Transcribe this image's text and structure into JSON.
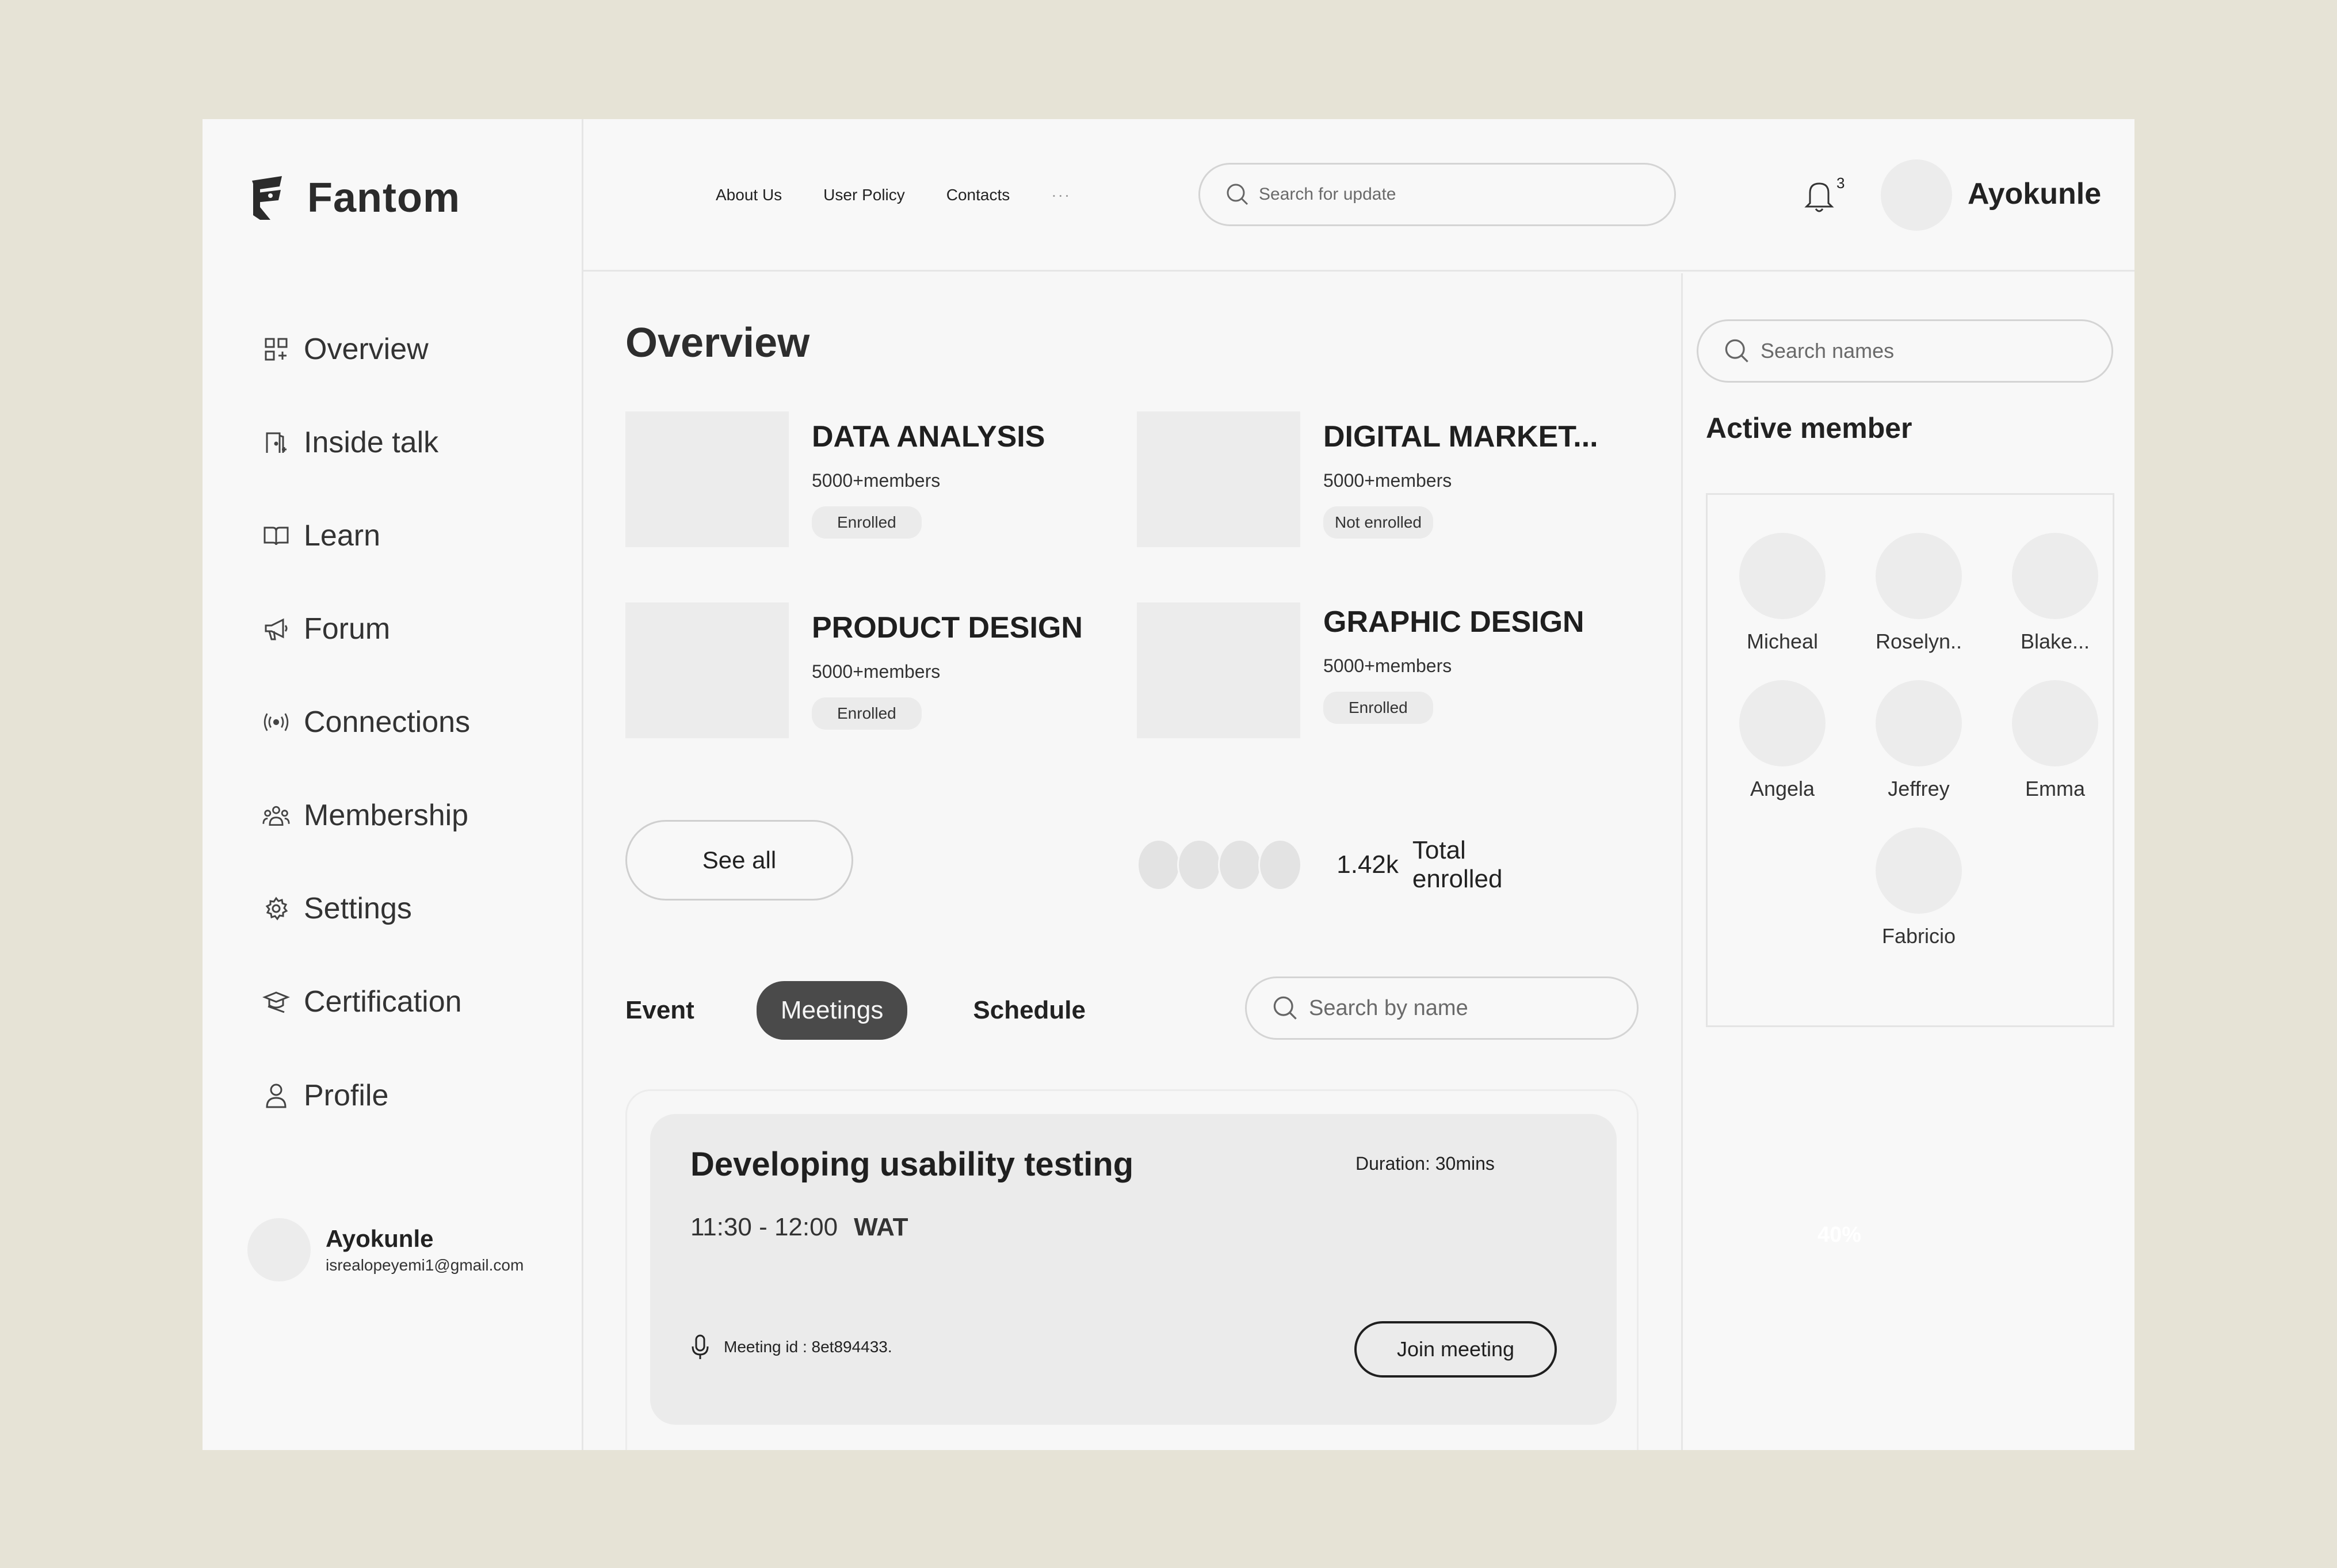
{
  "brand": {
    "name": "Fantom"
  },
  "sidebar": {
    "items": [
      {
        "label": "Overview",
        "icon": "grid-icon"
      },
      {
        "label": "Inside talk",
        "icon": "door-icon"
      },
      {
        "label": "Learn",
        "icon": "book-icon"
      },
      {
        "label": "Forum",
        "icon": "megaphone-icon"
      },
      {
        "label": "Connections",
        "icon": "broadcast-icon"
      },
      {
        "label": "Membership",
        "icon": "group-icon"
      },
      {
        "label": "Settings",
        "icon": "gear-icon"
      },
      {
        "label": "Certification",
        "icon": "graduation-icon"
      },
      {
        "label": "Profile",
        "icon": "user-icon"
      }
    ],
    "user": {
      "name": "Ayokunle",
      "email": "isrealopeyemi1@gmail.com"
    }
  },
  "header": {
    "links": [
      "About Us",
      "User Policy",
      "Contacts"
    ],
    "more": "···",
    "search_placeholder": "Search for update",
    "notification_count": "3",
    "username": "Ayokunle"
  },
  "main": {
    "title": "Overview",
    "courses": [
      {
        "title": "DATA ANALYSIS",
        "members": "5000+members",
        "status": "Enrolled"
      },
      {
        "title": "DIGITAL MARKET...",
        "members": "5000+members",
        "status": "Not enrolled"
      },
      {
        "title": "PRODUCT DESIGN",
        "members": "5000+members",
        "status": "Enrolled"
      },
      {
        "title": "GRAPHIC DESIGN",
        "members": "5000+members",
        "status": "Enrolled"
      }
    ],
    "see_all": "See all",
    "enrolled_count": "1.42k",
    "enrolled_label": "Total enrolled",
    "tabs": [
      "Event",
      "Meetings",
      "Schedule"
    ],
    "active_tab": "Meetings",
    "search_name_placeholder": "Search by name",
    "meeting": {
      "title": "Developing usability testing",
      "duration": "Duration: 30mins",
      "time": "11:30 - 12:00",
      "timezone": "WAT",
      "meeting_id": "Meeting id : 8et894433.",
      "join_label": "Join meeting"
    }
  },
  "right_panel": {
    "search_placeholder": "Search names",
    "title": "Active member",
    "members": [
      "Micheal",
      "Roselyn..",
      "Blake...",
      "Angela",
      "Jeffrey",
      "Emma",
      "Fabricio"
    ],
    "faint_text": "40%"
  }
}
